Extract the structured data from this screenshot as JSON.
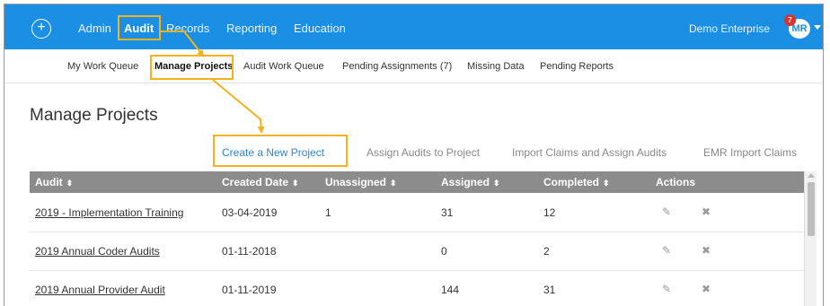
{
  "topnav": {
    "logo_glyph": "+",
    "items": [
      {
        "label": "Admin"
      },
      {
        "label": "Audit"
      },
      {
        "label": "Records"
      },
      {
        "label": "Reporting"
      },
      {
        "label": "Education"
      }
    ],
    "enterprise": "Demo Enterprise",
    "avatar_initials": "MR",
    "notification_count": "7"
  },
  "subnav": {
    "items": [
      {
        "label": "My Work Queue"
      },
      {
        "label": "Manage Projects"
      },
      {
        "label": "Audit Work Queue"
      },
      {
        "label": "Pending Assignments (7)"
      },
      {
        "label": "Missing Data"
      },
      {
        "label": "Pending Reports"
      }
    ]
  },
  "page": {
    "title": "Manage Projects"
  },
  "actions": {
    "create": "Create a New Project",
    "assign": "Assign Audits to Project",
    "import_claims": "Import Claims and Assign Audits",
    "emr_import": "EMR Import Claims"
  },
  "table": {
    "headers": [
      "Audit",
      "Created Date",
      "Unassigned",
      "Assigned",
      "Completed",
      "Actions"
    ],
    "sort_glyph": "⬍",
    "rows": [
      {
        "audit": "2019 - Implementation Training",
        "created": "03-04-2019",
        "unassigned": "1",
        "assigned": "31",
        "completed": "12"
      },
      {
        "audit": "2019 Annual Coder Audits",
        "created": "01-11-2018",
        "unassigned": "",
        "assigned": "0",
        "completed": "2"
      },
      {
        "audit": "2019 Annual Provider Audit",
        "created": "01-11-2019",
        "unassigned": "",
        "assigned": "144",
        "completed": "31"
      }
    ],
    "edit_glyph": "✎",
    "delete_glyph": "✖"
  },
  "colors": {
    "topnav_bg": "#1a8fe3",
    "highlight": "#f5b21a",
    "link_blue": "#2b86d6",
    "table_header": "#8c8c8c"
  }
}
